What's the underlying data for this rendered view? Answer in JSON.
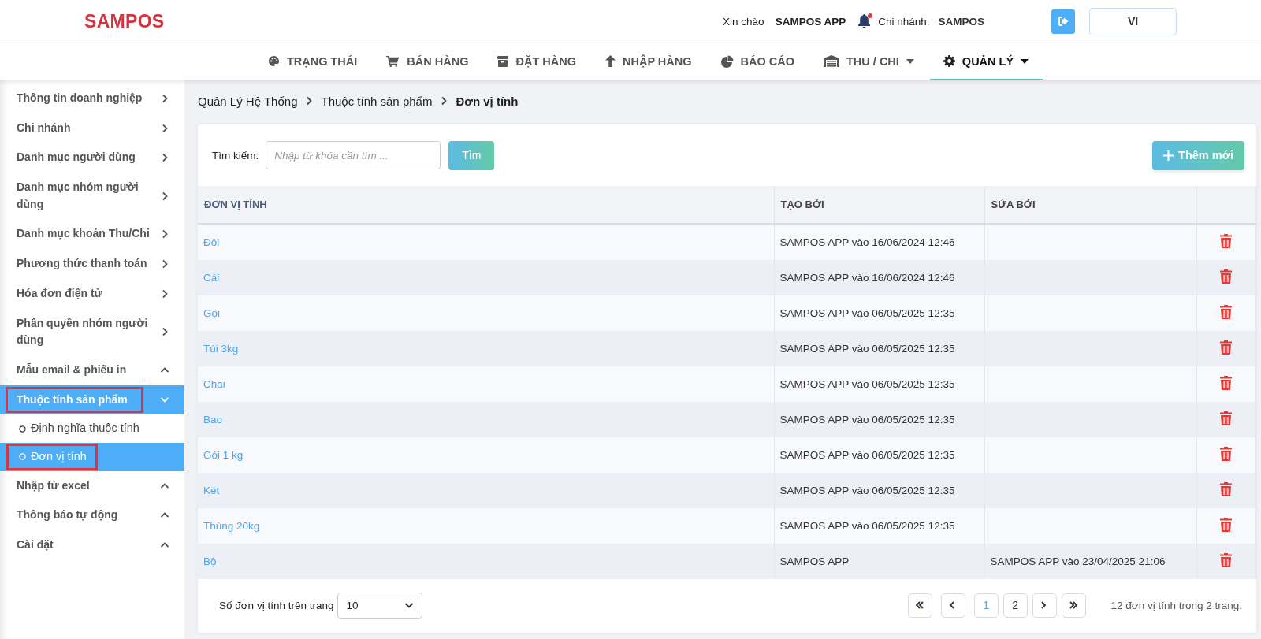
{
  "header": {
    "logo": "SAMPOS",
    "greeting": "Xin chào",
    "user": "SAMPOS APP",
    "notification": true,
    "branch_label": "Chi nhánh:",
    "branch": "SAMPOS",
    "language": "VI"
  },
  "nav": [
    {
      "label": "TRẠNG THÁI",
      "dropdown": false,
      "selected": false
    },
    {
      "label": "BÁN HÀNG",
      "dropdown": false,
      "selected": false
    },
    {
      "label": "ĐẶT HÀNG",
      "dropdown": false,
      "selected": false
    },
    {
      "label": "NHẬP HÀNG",
      "dropdown": false,
      "selected": false
    },
    {
      "label": "BÁO CÁO",
      "dropdown": false,
      "selected": false
    },
    {
      "label": "THU / CHI",
      "dropdown": true,
      "selected": false
    },
    {
      "label": "QUẢN LÝ",
      "dropdown": true,
      "selected": true
    }
  ],
  "sidebar": {
    "items": [
      {
        "kind": "link",
        "label": "Thông tin doanh nghiệp",
        "selected": false,
        "highlighted": false
      },
      {
        "kind": "link",
        "label": "Chi nhánh",
        "selected": false,
        "highlighted": false
      },
      {
        "kind": "link",
        "label": "Danh mục người dùng",
        "selected": false,
        "highlighted": false
      },
      {
        "kind": "link",
        "label": "Danh mục nhóm người dùng",
        "selected": false,
        "highlighted": false
      },
      {
        "kind": "link",
        "label": "Danh mục khoản Thu/Chi",
        "selected": false,
        "highlighted": false
      },
      {
        "kind": "link",
        "label": "Phương thức thanh toán",
        "selected": false,
        "highlighted": false
      },
      {
        "kind": "link",
        "label": "Hóa đơn điện tử",
        "selected": false,
        "highlighted": false
      },
      {
        "kind": "link",
        "label": "Phân quyền nhóm người dùng",
        "selected": false,
        "highlighted": false
      },
      {
        "kind": "group",
        "label": "Mẫu email & phiếu in",
        "expanded": false,
        "selected": false,
        "highlighted": false
      },
      {
        "kind": "group",
        "label": "Thuộc tính sản phẩm",
        "expanded": true,
        "selected": true,
        "highlighted": true,
        "children": [
          {
            "label": "Định nghĩa thuộc tính",
            "selected": false,
            "highlighted": false
          },
          {
            "label": "Đơn vị tính",
            "selected": true,
            "highlighted": true
          }
        ]
      },
      {
        "kind": "group",
        "label": "Nhập từ excel",
        "expanded": false,
        "selected": false,
        "highlighted": false
      },
      {
        "kind": "group",
        "label": "Thông báo tự động",
        "expanded": false,
        "selected": false,
        "highlighted": false
      },
      {
        "kind": "group",
        "label": "Cài đặt",
        "expanded": false,
        "selected": false,
        "highlighted": false
      }
    ]
  },
  "breadcrumb": [
    "Quản Lý Hệ Thống",
    "Thuộc tính sản phẩm",
    "Đơn vị tính"
  ],
  "search": {
    "label": "Tìm kiếm:",
    "placeholder": "Nhập từ khóa cần tìm ...",
    "button": "Tìm"
  },
  "add_button": "Thêm mới",
  "table": {
    "columns": [
      "ĐƠN VỊ TÍNH",
      "TẠO BỞI",
      "SỬA BỞI"
    ],
    "rows": [
      {
        "name": "Đôi",
        "created_by": "SAMPOS APP vào 16/06/2024 12:46",
        "modified_by": ""
      },
      {
        "name": "Cái",
        "created_by": "SAMPOS APP vào 16/06/2024 12:46",
        "modified_by": ""
      },
      {
        "name": "Gói",
        "created_by": "SAMPOS APP vào 06/05/2025 12:35",
        "modified_by": ""
      },
      {
        "name": "Túi 3kg",
        "created_by": "SAMPOS APP vào 06/05/2025 12:35",
        "modified_by": ""
      },
      {
        "name": "Chai",
        "created_by": "SAMPOS APP vào 06/05/2025 12:35",
        "modified_by": ""
      },
      {
        "name": "Bao",
        "created_by": "SAMPOS APP vào 06/05/2025 12:35",
        "modified_by": ""
      },
      {
        "name": "Gói 1 kg",
        "created_by": "SAMPOS APP vào 06/05/2025 12:35",
        "modified_by": ""
      },
      {
        "name": "Két",
        "created_by": "SAMPOS APP vào 06/05/2025 12:35",
        "modified_by": ""
      },
      {
        "name": "Thùng 20kg",
        "created_by": "SAMPOS APP vào 06/05/2025 12:35",
        "modified_by": ""
      },
      {
        "name": "Bộ",
        "created_by": "SAMPOS APP",
        "modified_by": "SAMPOS APP vào 23/04/2025 21:06"
      }
    ]
  },
  "footer": {
    "page_size_label": "Số đơn vị tính trên trang",
    "page_size": "10",
    "pages": [
      {
        "kind": "first"
      },
      {
        "kind": "prev"
      },
      {
        "kind": "page",
        "label": "1",
        "selected": true
      },
      {
        "kind": "page",
        "label": "2",
        "selected": false
      },
      {
        "kind": "next"
      },
      {
        "kind": "last"
      }
    ],
    "summary": "12 đơn vị tính trong 2 trang."
  }
}
